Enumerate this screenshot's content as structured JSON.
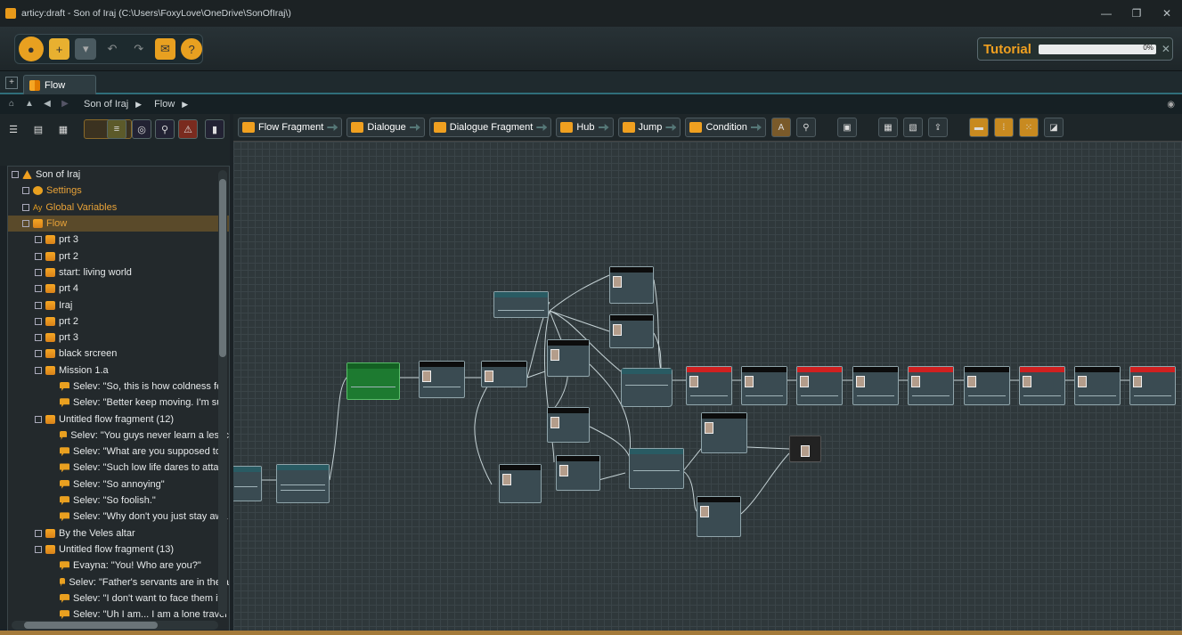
{
  "window": {
    "title": "articy:draft - Son of Iraj (C:\\Users\\FoxyLove\\OneDrive\\SonOfIraj\\)",
    "buttons": [
      "—",
      "❐",
      "✕"
    ]
  },
  "tutorial": {
    "label": "Tutorial",
    "percent": "0%",
    "progress": 0.0
  },
  "tabs": [
    {
      "label": "Flow"
    }
  ],
  "breadcrumb": [
    "Son of Iraj",
    "Flow"
  ],
  "flow_toolbar": [
    "Flow Fragment",
    "Dialogue",
    "Dialogue Fragment",
    "Hub",
    "Jump",
    "Condition"
  ],
  "tree": [
    {
      "label": "Son of Iraj",
      "icon": "root",
      "depth": 0,
      "color": "#e6e9ea"
    },
    {
      "label": "Settings",
      "icon": "gear",
      "depth": 1,
      "color": "#e8a238"
    },
    {
      "label": "Global Variables",
      "icon": "gv",
      "depth": 1,
      "color": "#e8a238"
    },
    {
      "label": "Flow",
      "icon": "frag",
      "depth": 1,
      "color": "#e8a238",
      "selected": true
    },
    {
      "label": "prt 3",
      "icon": "frag",
      "depth": 2
    },
    {
      "label": "prt 2",
      "icon": "frag",
      "depth": 2
    },
    {
      "label": "start: living world",
      "icon": "frag",
      "depth": 2
    },
    {
      "label": "prt 4",
      "icon": "frag",
      "depth": 2
    },
    {
      "label": "Iraj",
      "icon": "frag",
      "depth": 2
    },
    {
      "label": "prt 2",
      "icon": "frag",
      "depth": 2
    },
    {
      "label": "prt 3",
      "icon": "frag",
      "depth": 2
    },
    {
      "label": "black srcreen",
      "icon": "frag",
      "depth": 2
    },
    {
      "label": "Mission 1.a",
      "icon": "frag",
      "depth": 2
    },
    {
      "label": "Selev: \"So, this is how coldness fee",
      "icon": "dlg",
      "depth": 3
    },
    {
      "label": "Selev: \"Better keep moving. I'm sur",
      "icon": "dlg",
      "depth": 3
    },
    {
      "label": "Untitled flow fragment (12)",
      "icon": "frag",
      "depth": 2
    },
    {
      "label": "Selev: \"You guys never learn a lessc",
      "icon": "dlg",
      "depth": 3
    },
    {
      "label": "Selev: \"What are you supposed to l",
      "icon": "dlg",
      "depth": 3
    },
    {
      "label": "Selev: \"Such low life dares to attac",
      "icon": "dlg",
      "depth": 3
    },
    {
      "label": "Selev: \"So annoying\"",
      "icon": "dlg",
      "depth": 3
    },
    {
      "label": "Selev: \"So foolish.\"",
      "icon": "dlg",
      "depth": 3
    },
    {
      "label": "Selev: \"Why don't you just stay awa",
      "icon": "dlg",
      "depth": 3
    },
    {
      "label": "By the Veles altar",
      "icon": "frag",
      "depth": 2
    },
    {
      "label": "Untitled flow fragment (13)",
      "icon": "frag",
      "depth": 2
    },
    {
      "label": "Evayna: \"You! Who are you?\"",
      "icon": "dlg",
      "depth": 3
    },
    {
      "label": "Selev: \"Father's servants are in the a",
      "icon": "dlg",
      "depth": 3
    },
    {
      "label": "Selev: \"I don't want to face them if",
      "icon": "dlg",
      "depth": 3
    },
    {
      "label": "Selev: \"Uh I am... I am a lone travel",
      "icon": "dlg",
      "depth": 3
    }
  ]
}
